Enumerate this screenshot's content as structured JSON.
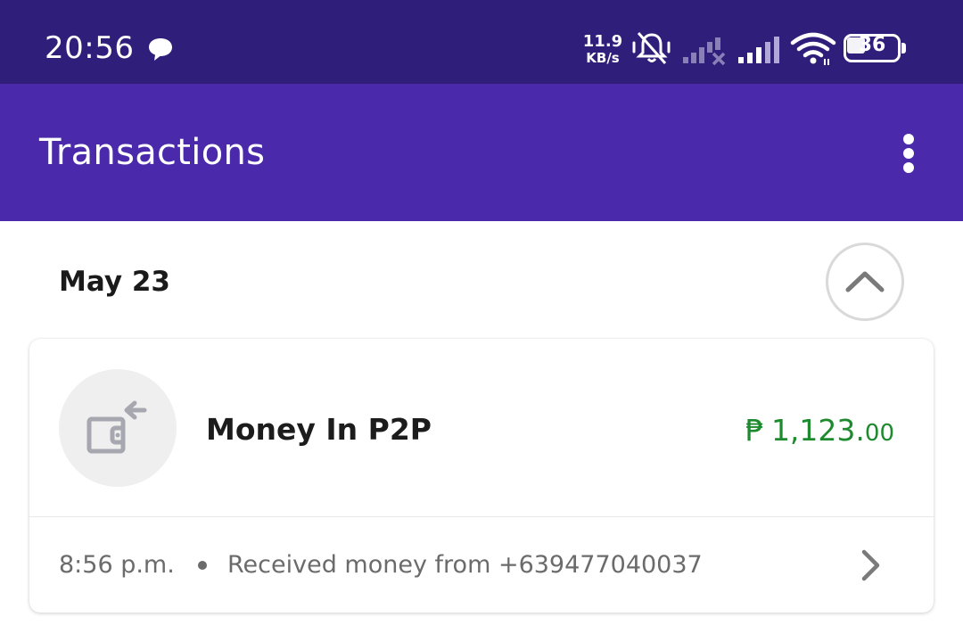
{
  "status_bar": {
    "time": "20:56",
    "net_speed_value": "11.9",
    "net_speed_unit": "KB/s",
    "battery_level": "36",
    "icons": [
      "chat-bubble-icon",
      "mute-icon",
      "signal-off-icon",
      "signal-icon",
      "wifi-icon",
      "battery-icon"
    ]
  },
  "app_bar": {
    "title": "Transactions",
    "menu_icon": "more-vert-icon"
  },
  "section": {
    "date": "May 23",
    "toggle_icon": "chevron-up-icon"
  },
  "transaction": {
    "icon": "wallet-in-icon",
    "title": "Money In P2P",
    "currency": "₱",
    "amount_whole": "1,123.",
    "amount_cents": "00",
    "amount_color": "#1e8a2e",
    "time": "8:56 p.m.",
    "description": "Received money from +639477040037",
    "detail_icon": "chevron-right-icon"
  },
  "colors": {
    "status_bar": "#2f1f7a",
    "app_bar": "#4a2aab"
  }
}
